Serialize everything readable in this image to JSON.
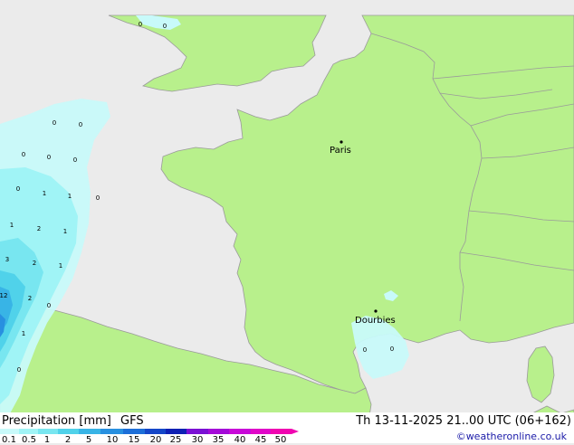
{
  "map": {
    "cities": [
      {
        "id": "paris",
        "name": "Paris"
      },
      {
        "id": "dourbies",
        "name": "Dourbies"
      }
    ],
    "precip_values": [
      "0",
      "0",
      "0",
      "0",
      "0",
      "0",
      "0",
      "1",
      "1",
      "0",
      "1",
      "2",
      "1",
      "3",
      "2",
      "1",
      "12",
      "2",
      "1",
      "0",
      "0",
      "0",
      "0",
      "0"
    ],
    "colors": {
      "land": "#b8f08c",
      "sea": "#ebebeb",
      "border": "#9a9a9a"
    }
  },
  "legend": {
    "title": "Precipitation [mm]",
    "model": "GFS",
    "run_info": "Th 13-11-2025 21..00 UTC (06+162)",
    "credit": "©weatheronline.co.uk",
    "ticks": [
      "0.1",
      "0.5",
      "1",
      "2",
      "5",
      "10",
      "15",
      "20",
      "25",
      "30",
      "35",
      "40",
      "45",
      "50"
    ],
    "colors": [
      "#c8fafa",
      "#a0f4f6",
      "#78e6f0",
      "#50d2ea",
      "#38b4e6",
      "#2890e0",
      "#1c6ed8",
      "#1446c8",
      "#0e20b4",
      "#7a10d4",
      "#a40ad8",
      "#c808d8",
      "#e006c8",
      "#f004b0"
    ]
  }
}
